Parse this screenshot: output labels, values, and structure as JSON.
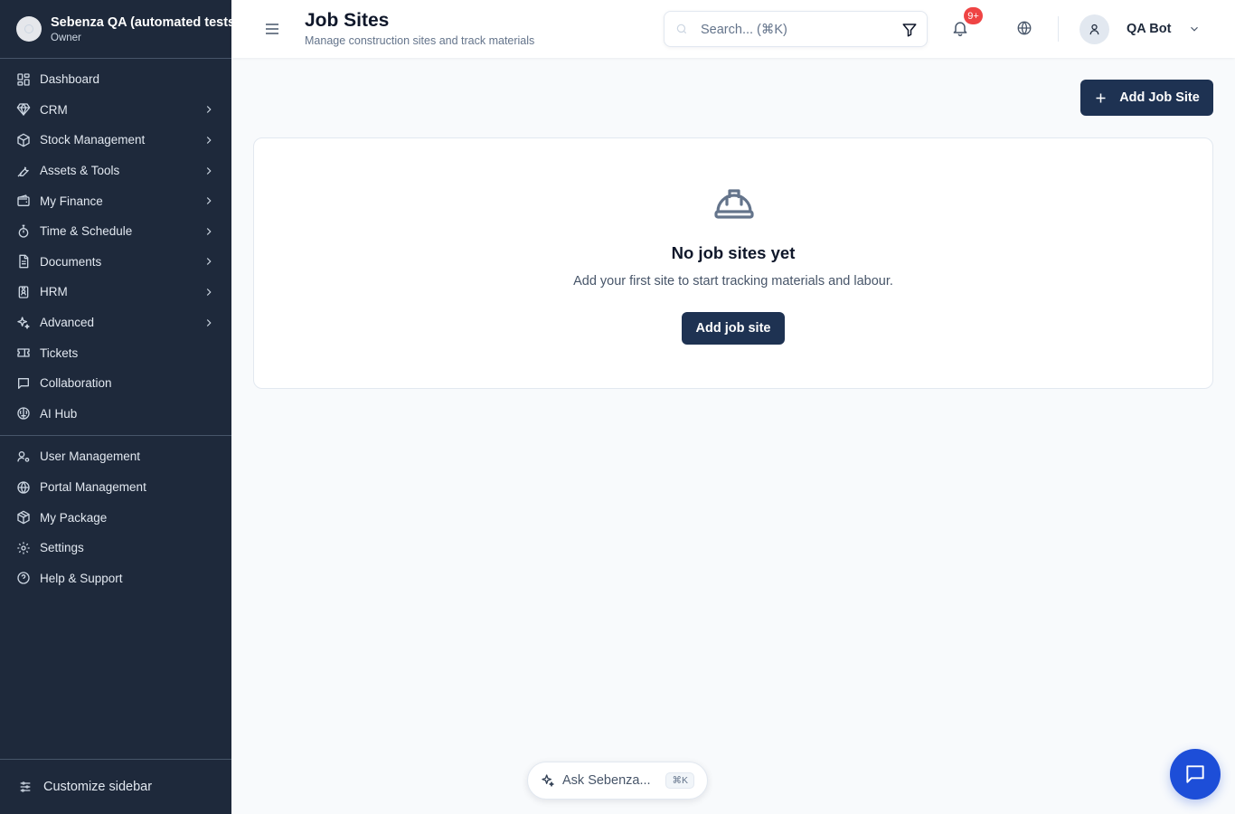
{
  "org": {
    "name": "Sebenza QA (automated tests)",
    "role": "Owner"
  },
  "sidebar": {
    "items": [
      {
        "label": "Dashboard",
        "icon": "dashboard-icon",
        "has_children": false
      },
      {
        "label": "CRM",
        "icon": "diamond-icon",
        "has_children": true
      },
      {
        "label": "Stock Management",
        "icon": "box-icon",
        "has_children": true
      },
      {
        "label": "Assets & Tools",
        "icon": "wrench-icon",
        "has_children": true
      },
      {
        "label": "My Finance",
        "icon": "wallet-icon",
        "has_children": true
      },
      {
        "label": "Time & Schedule",
        "icon": "stopwatch-icon",
        "has_children": true
      },
      {
        "label": "Documents",
        "icon": "document-icon",
        "has_children": true
      },
      {
        "label": "HRM",
        "icon": "id-badge-icon",
        "has_children": true
      },
      {
        "label": "Advanced",
        "icon": "sparkles-icon",
        "has_children": true
      },
      {
        "label": "Tickets",
        "icon": "ticket-icon",
        "has_children": false
      },
      {
        "label": "Collaboration",
        "icon": "message-square-icon",
        "has_children": false
      },
      {
        "label": "AI Hub",
        "icon": "brain-icon",
        "has_children": false
      }
    ],
    "admin_items": [
      {
        "label": "User Management",
        "icon": "user-cog-icon"
      },
      {
        "label": "Portal Management",
        "icon": "globe-icon"
      },
      {
        "label": "My Package",
        "icon": "package-icon"
      },
      {
        "label": "Settings",
        "icon": "gear-icon"
      },
      {
        "label": "Help & Support",
        "icon": "help-circle-icon"
      }
    ],
    "customize_label": "Customize sidebar"
  },
  "header": {
    "title": "Job Sites",
    "subtitle": "Manage construction sites and track materials",
    "search_placeholder": "Search... (⌘K)",
    "notification_badge": "9+",
    "user_name": "QA Bot"
  },
  "main": {
    "add_button_label": "Add Job Site",
    "empty_state": {
      "icon": "hard-hat-icon",
      "title": "No job sites yet",
      "text": "Add your first site to start tracking materials and labour.",
      "button_label": "Add job site"
    }
  },
  "ask": {
    "label": "Ask Sebenza...",
    "shortcut": "⌘K"
  },
  "colors": {
    "sidebar_bg": "#1e293b",
    "primary_button": "#1e3252",
    "badge": "#ef4444",
    "chat_button": "#1d4ed8"
  }
}
